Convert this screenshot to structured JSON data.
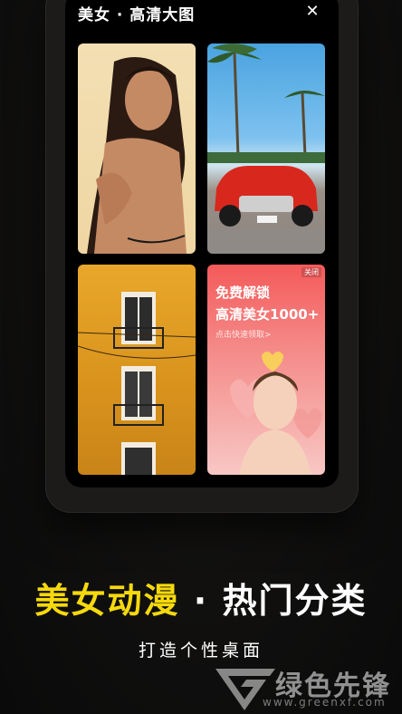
{
  "modal": {
    "title": "美女 · 高清大图",
    "close_icon": "close-icon"
  },
  "cards": [
    {
      "name": "portrait-woman-image"
    },
    {
      "name": "red-car-palm-trees-image"
    },
    {
      "name": "yellow-building-image"
    },
    {
      "name": "ad-card",
      "badge": "关闭",
      "line1": "免费解锁",
      "line2": "高清美女1000+",
      "link": "点击快速领取>"
    }
  ],
  "headline": {
    "part1": "美女动漫",
    "separator": "·",
    "part2": "热门分类"
  },
  "subline": "打造个性桌面",
  "watermark": {
    "text": "绿色先锋",
    "url": "www.greenxf.com"
  },
  "colors": {
    "accent_yellow": "#f6d90c",
    "background": "#0a0a0a"
  }
}
